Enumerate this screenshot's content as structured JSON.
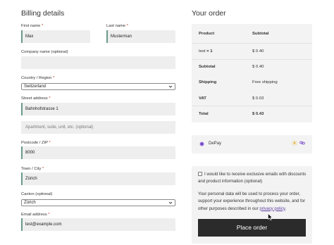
{
  "billing": {
    "title": "Billing details",
    "first_name": {
      "label": "First name",
      "value": "Max"
    },
    "last_name": {
      "label": "Last name",
      "value": "Musterman"
    },
    "company": {
      "label": "Company name (optional)",
      "value": ""
    },
    "country": {
      "label": "Country / Region",
      "value": "Switzerland"
    },
    "street": {
      "label": "Street address",
      "value": "Bahnhofstrasse 1",
      "placeholder2": "Apartment, suite, unit, etc. (optional)"
    },
    "postcode": {
      "label": "Postcode / ZIP",
      "value": "8000"
    },
    "city": {
      "label": "Town / City",
      "value": "Zürich"
    },
    "canton": {
      "label": "Canton (optional)",
      "value": "Zürich"
    },
    "email": {
      "label": "Email address",
      "value": "test@example.com"
    },
    "required_mark": "*"
  },
  "order": {
    "title": "Your order",
    "header": {
      "product": "Product",
      "subtotal": "Subtotal"
    },
    "item": {
      "name": "test",
      "qty": "× 1",
      "price": "$ 0.40"
    },
    "subtotal": {
      "label": "Subtotal",
      "value": "$ 0.40"
    },
    "shipping": {
      "label": "Shipping",
      "value": "Free shipping"
    },
    "vat": {
      "label": "VAT",
      "value": "$ 0.03"
    },
    "total": {
      "label": "Total",
      "value": "$ 0.43"
    }
  },
  "payment": {
    "method_label": "DePay",
    "accent": "#7b4fc9"
  },
  "terms": {
    "newsletter_text": "I would like to receive exclusive emails with discounts and product information (optional)",
    "privacy_prefix": "Your personal data will be used to process your order, support your experience throughout this website, and for other purposes described in our ",
    "privacy_link": "privacy policy",
    "privacy_suffix": "."
  },
  "place_order": {
    "label": "Place order"
  }
}
